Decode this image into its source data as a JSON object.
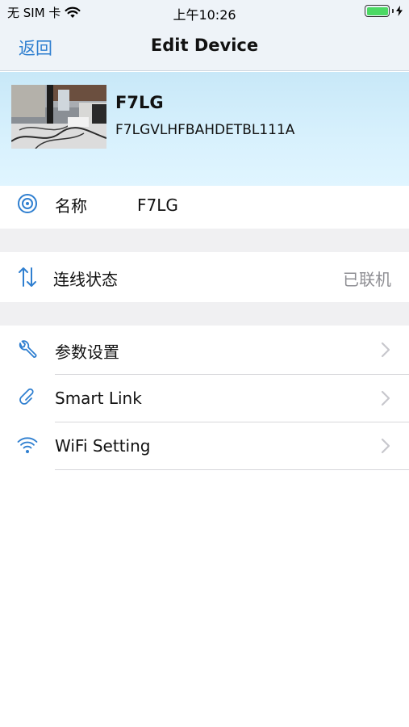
{
  "status_bar": {
    "carrier": "无 SIM 卡",
    "time": "上午10:26",
    "battery_level": 1.0,
    "wifi_icon": "wifi-icon",
    "charging_icon": "bolt-icon"
  },
  "nav": {
    "back_label": "返回",
    "title": "Edit Device"
  },
  "device": {
    "name": "F7LG",
    "id": "F7LGVLHFBAHDETBL111A",
    "thumbnail_icon": "device-photo"
  },
  "rows": {
    "name": {
      "label": "名称",
      "value": "F7LG",
      "icon": "camera-lens-icon"
    },
    "connection": {
      "label": "连线状态",
      "value": "已联机",
      "icon": "up-down-arrows-icon"
    },
    "settings": {
      "label": "参数设置",
      "icon": "wrench-icon"
    },
    "smart_link": {
      "label": "Smart Link",
      "icon": "link-icon"
    },
    "wifi": {
      "label": "WiFi Setting",
      "icon": "wifi-icon"
    }
  },
  "colors": {
    "accent": "#2f7fd0",
    "header_bg": "#d8f1fd",
    "secondary_text": "#8e8e93",
    "battery": "#4cd964"
  }
}
